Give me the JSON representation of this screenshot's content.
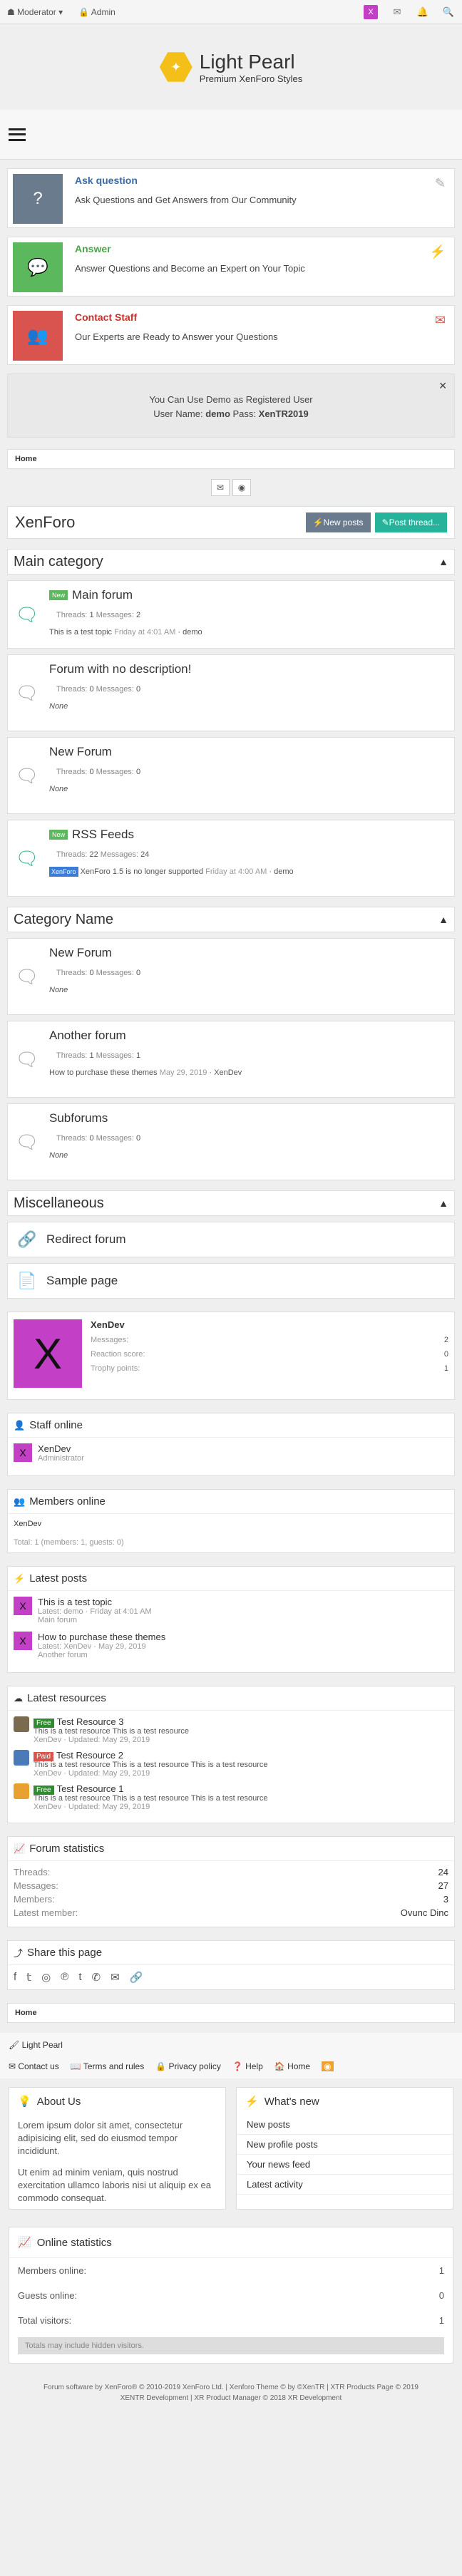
{
  "topbar": {
    "moderator": "Moderator ▾",
    "admin": "Admin",
    "avatar": "X"
  },
  "logo": {
    "title": "Light Pearl",
    "subtitle": "Premium XenForo Styles"
  },
  "features": [
    {
      "title": "Ask question",
      "desc": "Ask Questions and Get Answers from Our Community",
      "color": "#6a7b8e",
      "titlecolor": "#3a6aa8"
    },
    {
      "title": "Answer",
      "desc": "Answer Questions and Become an Expert on Your Topic",
      "color": "#5cb85c",
      "titlecolor": "#4aa64a"
    },
    {
      "title": "Contact Staff",
      "desc": "Our Experts are Ready to Answer your Questions",
      "color": "#d9534f",
      "titlecolor": "#c9302c"
    }
  ],
  "notice": {
    "line1": "You Can Use Demo as Registered User",
    "label_user": "User Name:",
    "user": "demo",
    "label_pass": "Pass:",
    "pass": "XenTR2019"
  },
  "breadcrumb": "Home",
  "page": {
    "title": "XenForo",
    "new_posts": "New posts",
    "post_thread": "Post thread..."
  },
  "cat1": {
    "title": "Main category",
    "nodes": [
      {
        "title": "Main forum",
        "new": "New",
        "threads": "Threads:",
        "threads_v": "1",
        "messages": "Messages:",
        "messages_v": "2",
        "last": "This is a test topic",
        "date": "Friday at 4:01 AM",
        "user": "demo"
      },
      {
        "title": "Forum with no description!",
        "threads": "Threads:",
        "threads_v": "0",
        "messages": "Messages:",
        "messages_v": "0",
        "last": "None"
      },
      {
        "title": "New Forum",
        "threads": "Threads:",
        "threads_v": "0",
        "messages": "Messages:",
        "messages_v": "0",
        "last": "None"
      },
      {
        "title": "RSS Feeds",
        "new": "New",
        "threads": "Threads:",
        "threads_v": "22",
        "messages": "Messages:",
        "messages_v": "24",
        "tag": "XenForo",
        "last": "XenForo 1.5 is no longer supported",
        "date": "Friday at 4:00 AM",
        "user": "demo"
      }
    ]
  },
  "cat2": {
    "title": "Category Name",
    "nodes": [
      {
        "title": "New Forum",
        "threads": "Threads:",
        "threads_v": "0",
        "messages": "Messages:",
        "messages_v": "0",
        "last": "None"
      },
      {
        "title": "Another forum",
        "threads": "Threads:",
        "threads_v": "1",
        "messages": "Messages:",
        "messages_v": "1",
        "last": "How to purchase these themes",
        "date": "May 29, 2019",
        "user": "XenDev"
      },
      {
        "title": "Subforums",
        "threads": "Threads:",
        "threads_v": "0",
        "messages": "Messages:",
        "messages_v": "0",
        "last": "None"
      }
    ]
  },
  "cat3": {
    "title": "Miscellaneous",
    "links": [
      "Redirect forum",
      "Sample page"
    ]
  },
  "userbox": {
    "avatar": "X",
    "name": "XenDev",
    "rows": [
      {
        "k": "Messages:",
        "v": "2"
      },
      {
        "k": "Reaction score:",
        "v": "0"
      },
      {
        "k": "Trophy points:",
        "v": "1"
      }
    ]
  },
  "staff": {
    "title": "Staff online",
    "name": "XenDev",
    "role": "Administrator",
    "avatar": "X"
  },
  "members": {
    "title": "Members online",
    "name": "XenDev",
    "total": "Total: 1 (members: 1, guests: 0)"
  },
  "latest": {
    "title": "Latest posts",
    "items": [
      {
        "title": "This is a test topic",
        "meta": "Latest: demo · Friday at 4:01 AM",
        "forum": "Main forum"
      },
      {
        "title": "How to purchase these themes",
        "meta": "Latest: XenDev · May 29, 2019",
        "forum": "Another forum"
      }
    ]
  },
  "resources": {
    "title": "Latest resources",
    "items": [
      {
        "tag": "Free",
        "tagcolor": "#2e8b2e",
        "title": "Test Resource 3",
        "desc": "This is a test resource This is a test resource",
        "meta": "XenDev · Updated: May 29, 2019",
        "img": "#7a6a50"
      },
      {
        "tag": "Paid",
        "tagcolor": "#d9534f",
        "title": "Test Resource 2",
        "desc": "This is a test resource This is a test resource This is a test resource",
        "meta": "XenDev · Updated: May 29, 2019",
        "img": "#4a7ab8"
      },
      {
        "tag": "Free",
        "tagcolor": "#2e8b2e",
        "title": "Test Resource 1",
        "desc": "This is a test resource This is a test resource This is a test resource",
        "meta": "XenDev · Updated: May 29, 2019",
        "img": "#e8a030"
      }
    ]
  },
  "fstats": {
    "title": "Forum statistics",
    "rows": [
      {
        "k": "Threads:",
        "v": "24"
      },
      {
        "k": "Messages:",
        "v": "27"
      },
      {
        "k": "Members:",
        "v": "3"
      },
      {
        "k": "Latest member:",
        "v": "Ovunc Dinc"
      }
    ]
  },
  "share": {
    "title": "Share this page"
  },
  "footer": {
    "home": "Home",
    "brand": "Light Pearl",
    "links": [
      "Contact us",
      "Terms and rules",
      "Privacy policy",
      "Help",
      "Home"
    ]
  },
  "about": {
    "title": "About Us",
    "p1": "Lorem ipsum dolor sit amet, consectetur adipisicing elit, sed do eiusmod tempor incididunt.",
    "p2": "Ut enim ad minim veniam, quis nostrud exercitation ullamco laboris nisi ut aliquip ex ea commodo consequat."
  },
  "whatsnew": {
    "title": "What's new",
    "items": [
      "New posts",
      "New profile posts",
      "Your news feed",
      "Latest activity"
    ]
  },
  "ostats": {
    "title": "Online statistics",
    "rows": [
      {
        "k": "Members online:",
        "v": "1"
      },
      {
        "k": "Guests online:",
        "v": "0"
      },
      {
        "k": "Total visitors:",
        "v": "1"
      }
    ],
    "hidden": "Totals may include hidden visitors."
  },
  "copyright": {
    "l1": "Forum software by XenForo® © 2010-2019 XenForo Ltd. | Xenforo Theme © by ©XenTR | XTR Products Page © 2019",
    "l2": "XENTR Development | XR Product Manager © 2018 XR Development"
  }
}
